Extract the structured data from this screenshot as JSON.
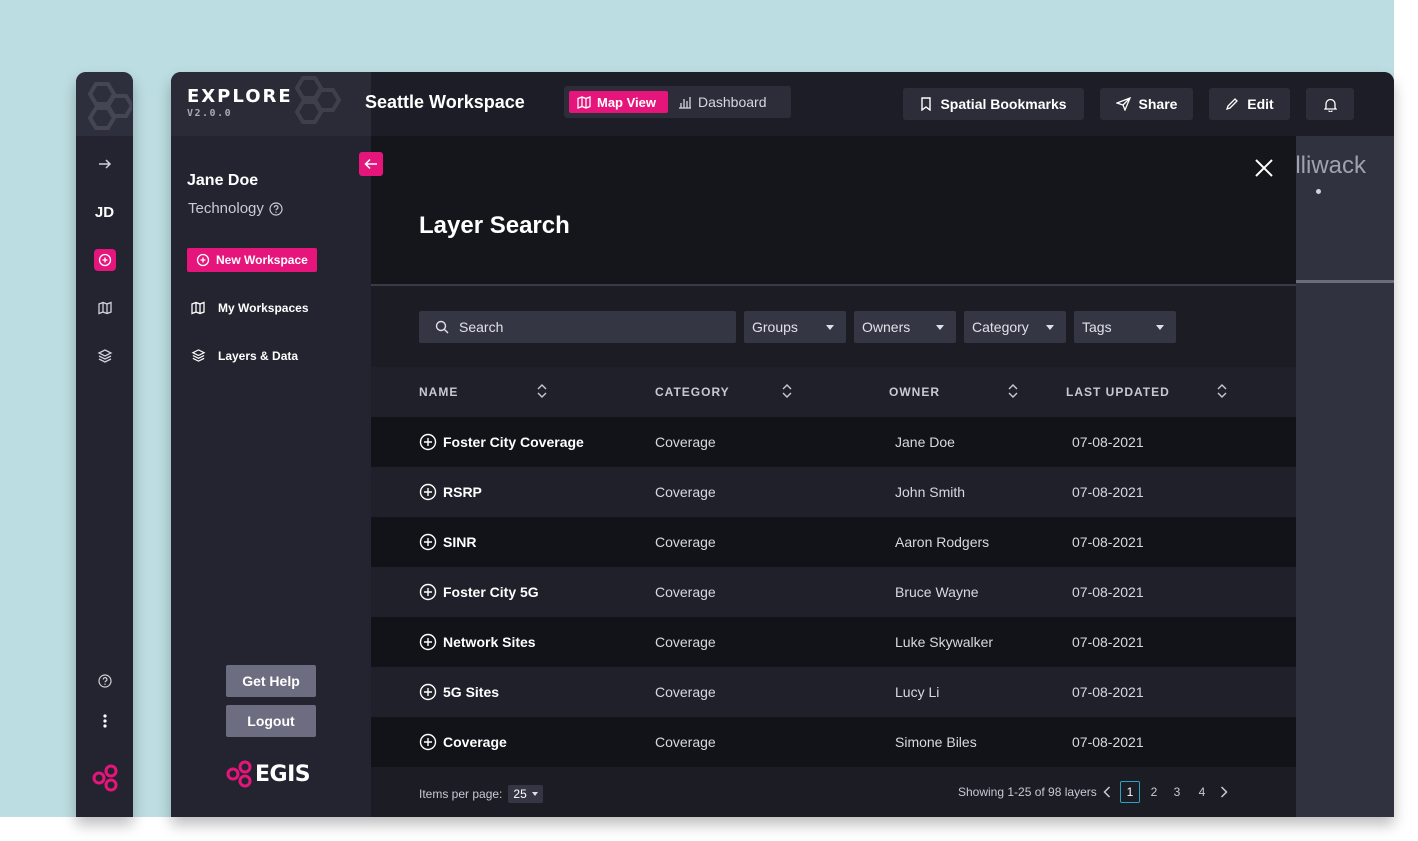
{
  "app": {
    "logo": "EXPLORE",
    "version": "V2.0.0",
    "workspace_title": "Seattle Workspace",
    "brand": "EGIS",
    "accent_color": "#e5157b"
  },
  "view_toggle": {
    "map_view": "Map View",
    "dashboard": "Dashboard",
    "selected": "Map View"
  },
  "topbar": {
    "bookmarks": "Spatial Bookmarks",
    "share": "Share",
    "edit": "Edit",
    "notifications_icon": "bell-icon"
  },
  "rail": {
    "initials": "JD"
  },
  "sidebar": {
    "user_name": "Jane Doe",
    "department": "Technology",
    "new_workspace": "New Workspace",
    "items": [
      {
        "label": "My Workspaces",
        "icon": "map-icon"
      },
      {
        "label": "Layers & Data",
        "icon": "layers-icon"
      }
    ],
    "get_help": "Get Help",
    "logout": "Logout"
  },
  "map": {
    "place_label": "illiwack"
  },
  "layer_search": {
    "title": "Layer Search",
    "search_placeholder": "Search",
    "filters": [
      "Groups",
      "Owners",
      "Category",
      "Tags"
    ],
    "columns": [
      "NAME",
      "CATEGORY",
      "OWNER",
      "LAST UPDATED"
    ],
    "rows": [
      {
        "name": "Foster City Coverage",
        "category": "Coverage",
        "owner": "Jane Doe",
        "updated": "07-08-2021"
      },
      {
        "name": "RSRP",
        "category": "Coverage",
        "owner": "John Smith",
        "updated": "07-08-2021"
      },
      {
        "name": "SINR",
        "category": "Coverage",
        "owner": "Aaron Rodgers",
        "updated": "07-08-2021"
      },
      {
        "name": "Foster City 5G",
        "category": "Coverage",
        "owner": "Bruce Wayne",
        "updated": "07-08-2021"
      },
      {
        "name": "Network Sites",
        "category": "Coverage",
        "owner": "Luke Skywalker",
        "updated": "07-08-2021"
      },
      {
        "name": "5G Sites",
        "category": "Coverage",
        "owner": "Lucy Li",
        "updated": "07-08-2021"
      },
      {
        "name": "Coverage",
        "category": "Coverage",
        "owner": "Simone Biles",
        "updated": "07-08-2021"
      }
    ],
    "pagination": {
      "items_per_page_label": "Items per page:",
      "items_per_page": "25",
      "showing": "Showing 1-25 of 98 layers",
      "pages": [
        "1",
        "2",
        "3",
        "4"
      ],
      "current_page": "1"
    }
  }
}
